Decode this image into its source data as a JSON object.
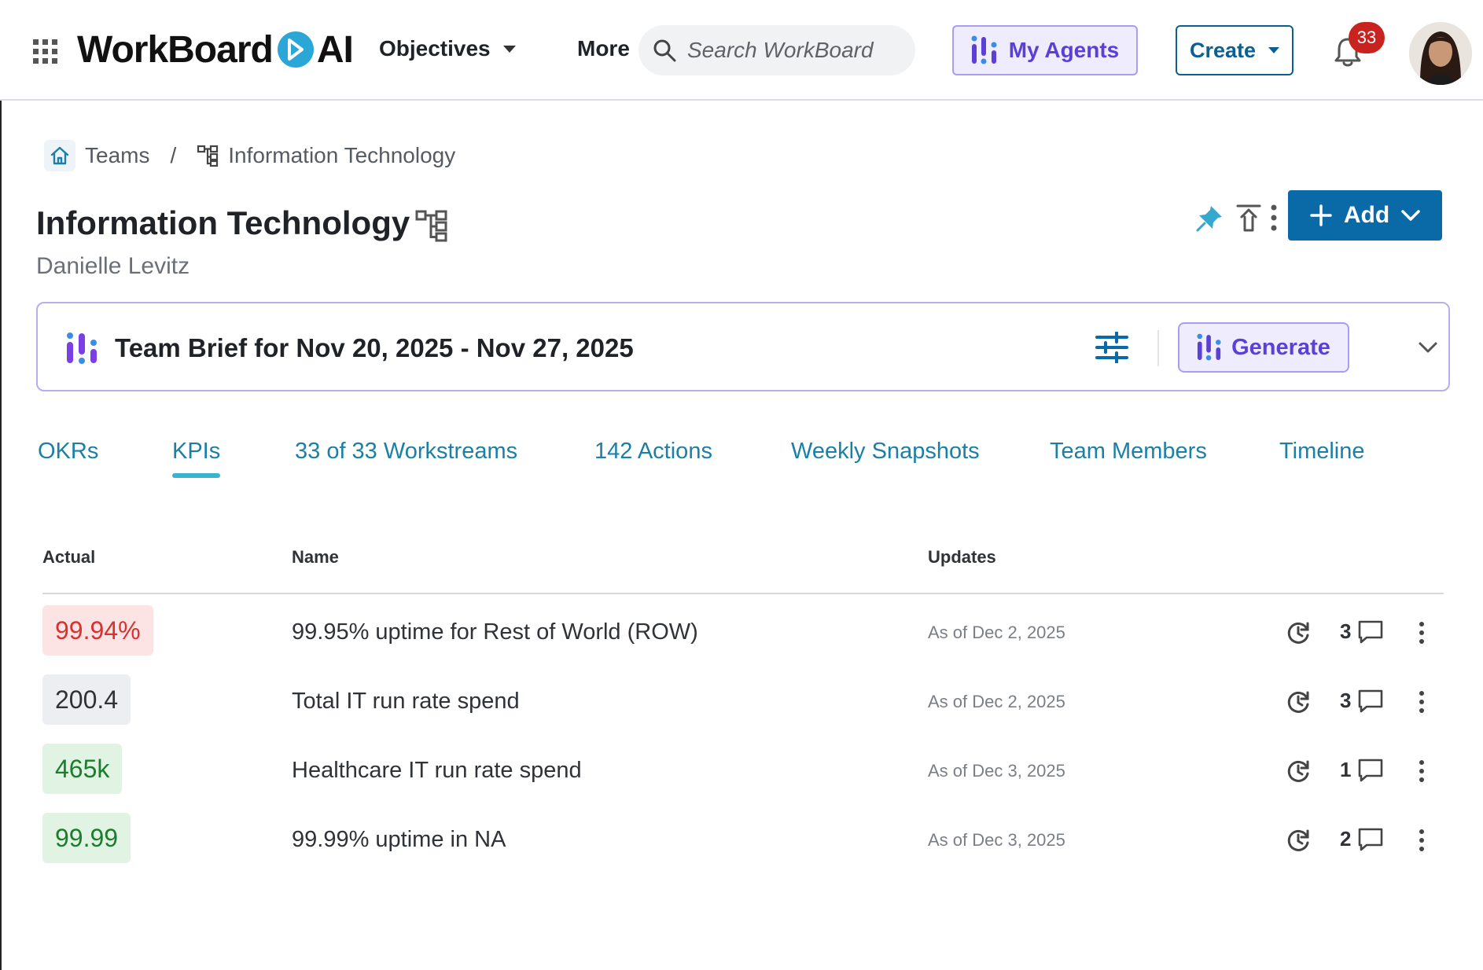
{
  "topbar": {
    "brand": "WorkBoard",
    "brand_ai": "AI",
    "nav_objectives": "Objectives",
    "nav_more": "More",
    "search_placeholder": "Search WorkBoard",
    "my_agents": "My Agents",
    "create": "Create",
    "notifications_count": "33"
  },
  "breadcrumb": {
    "teams": "Teams",
    "separator": "/",
    "current": "Information Technology"
  },
  "header": {
    "title": "Information Technology",
    "owner": "Danielle Levitz",
    "add_label": "Add"
  },
  "brief": {
    "title": "Team Brief for Nov 20, 2025 - Nov 27, 2025",
    "generate": "Generate"
  },
  "tabs": [
    {
      "label": "OKRs",
      "active": false
    },
    {
      "label": "KPIs",
      "active": true
    },
    {
      "label": "33 of 33 Workstreams",
      "active": false
    },
    {
      "label": "142 Actions",
      "active": false
    },
    {
      "label": "Weekly Snapshots",
      "active": false
    },
    {
      "label": "Team Members",
      "active": false
    },
    {
      "label": "Timeline",
      "active": false
    }
  ],
  "table": {
    "columns": {
      "actual": "Actual",
      "name": "Name",
      "updates": "Updates"
    },
    "rows": [
      {
        "actual": "99.94%",
        "status": "red",
        "name": "99.95% uptime for Rest of World (ROW)",
        "updated": "As of Dec 2, 2025",
        "comments": "3"
      },
      {
        "actual": "200.4",
        "status": "gray",
        "name": "Total IT run rate spend",
        "updated": "As of Dec 2, 2025",
        "comments": "3"
      },
      {
        "actual": "465k",
        "status": "green",
        "name": "Healthcare IT run rate spend",
        "updated": "As of Dec 3, 2025",
        "comments": "1"
      },
      {
        "actual": "99.99",
        "status": "green",
        "name": "99.99% uptime in NA",
        "updated": "As of Dec 3, 2025",
        "comments": "2"
      }
    ]
  },
  "colors": {
    "accent_blue": "#0a6aa8",
    "tab_blue": "#1b7fa6",
    "agent_purple": "#5b3fd6",
    "status_red": "#d93131",
    "status_green": "#1d7d2e",
    "badge_red": "#c8231e"
  },
  "icons": {
    "apps": "grid-icon",
    "search": "search-icon",
    "agents": "agent-bars-icon",
    "bell": "bell-icon",
    "home": "home-icon",
    "hierarchy": "org-tree-icon",
    "pin": "pin-icon",
    "upload": "upload-icon",
    "more": "kebab-icon",
    "settings": "sliders-icon",
    "chevron": "chevron-down-icon",
    "refresh": "history-icon",
    "comment": "comment-icon"
  }
}
